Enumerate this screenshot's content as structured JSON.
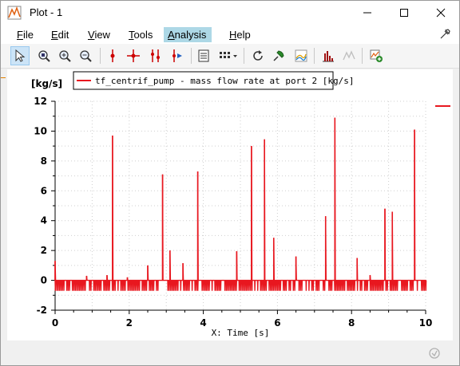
{
  "window": {
    "title": "Plot - 1"
  },
  "menu": {
    "items": [
      "File",
      "Edit",
      "View",
      "Tools",
      "Analysis",
      "Help"
    ],
    "active": "Analysis"
  },
  "toolbar": {
    "icons": [
      "cursor-icon",
      "zoom-region-icon",
      "zoom-in-icon",
      "zoom-out-icon",
      "marker-icon",
      "crosshair-icon",
      "multi-marker-icon",
      "marker-play-icon",
      "table-view-icon",
      "grid-options-icon",
      "refresh-icon",
      "pin-icon",
      "spectrum-icon",
      "histogram-icon",
      "disabled-plot-icon",
      "add-plot-icon"
    ]
  },
  "chart_data": {
    "type": "line",
    "title": "",
    "ylabel": "[kg/s]",
    "xlabel": "X: Time [s]",
    "xlim": [
      0,
      10
    ],
    "ylim": [
      -2,
      12
    ],
    "xticks": [
      0,
      2,
      4,
      6,
      8,
      10
    ],
    "yticks": [
      -2,
      0,
      2,
      4,
      6,
      8,
      10,
      12
    ],
    "grid": true,
    "legend_position": "top",
    "series": [
      {
        "name": "tf_centrif_pump - mass flow rate at port 2 [kg/s]",
        "color": "#e8171f",
        "baseline": 0,
        "baseline_noise_min": -0.7,
        "spikes": [
          {
            "x": 0.0,
            "y": 1.3
          },
          {
            "x": 0.85,
            "y": 0.3
          },
          {
            "x": 1.4,
            "y": 0.35
          },
          {
            "x": 1.55,
            "y": 9.7
          },
          {
            "x": 1.95,
            "y": 0.2
          },
          {
            "x": 2.5,
            "y": 1.0
          },
          {
            "x": 2.9,
            "y": 7.1
          },
          {
            "x": 3.1,
            "y": 2.0
          },
          {
            "x": 3.45,
            "y": 1.15
          },
          {
            "x": 3.85,
            "y": 7.3
          },
          {
            "x": 4.9,
            "y": 1.95
          },
          {
            "x": 5.3,
            "y": 9.0
          },
          {
            "x": 5.65,
            "y": 9.45
          },
          {
            "x": 5.9,
            "y": 2.85
          },
          {
            "x": 6.5,
            "y": 1.6
          },
          {
            "x": 7.3,
            "y": 4.3
          },
          {
            "x": 7.55,
            "y": 10.9
          },
          {
            "x": 8.15,
            "y": 1.5
          },
          {
            "x": 8.5,
            "y": 0.35
          },
          {
            "x": 8.9,
            "y": 4.8
          },
          {
            "x": 9.1,
            "y": 4.6
          },
          {
            "x": 9.7,
            "y": 10.1
          }
        ]
      }
    ]
  }
}
